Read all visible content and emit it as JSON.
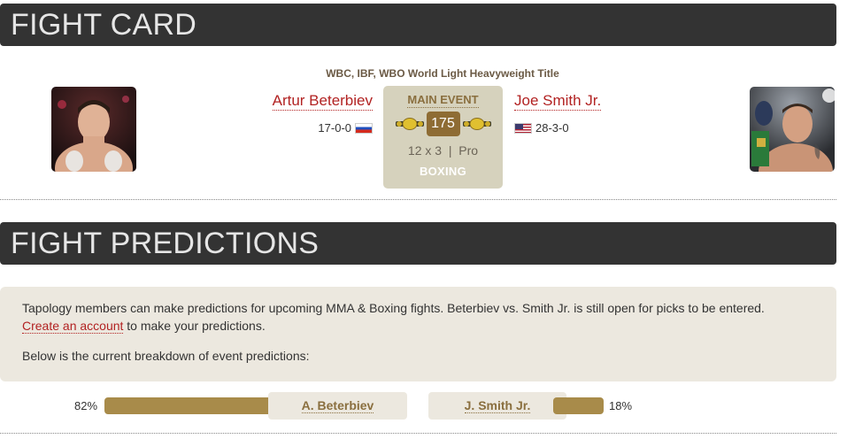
{
  "fight_card": {
    "header": "FIGHT CARD",
    "title_belt": "WBC, IBF, WBO World Light Heavyweight Title",
    "fighter_left": {
      "name": "Artur Beterbiev",
      "record": "17-0-0",
      "flag": "russia-flag-icon"
    },
    "fighter_right": {
      "name": "Joe Smith Jr.",
      "record": "28-3-0",
      "flag": "usa-flag-icon"
    },
    "event": {
      "label": "MAIN EVENT",
      "weight": "175",
      "rounds": "12 x 3",
      "separator": "|",
      "level": "Pro",
      "sport": "BOXING"
    }
  },
  "predictions": {
    "header": "FIGHT PREDICTIONS",
    "intro_text": "Tapology members can make predictions for upcoming MMA & Boxing fights. Beterbiev vs. Smith Jr. is still open for picks to be entered.",
    "link_text": "Create an account",
    "link_suffix": " to make your predictions.",
    "breakdown_text": "Below is the current breakdown of event predictions:",
    "left": {
      "percent_label": "82%",
      "percent": 82,
      "button": "A. Beterbiev"
    },
    "right": {
      "percent_label": "18%",
      "percent": 18,
      "button": "J. Smith Jr."
    }
  },
  "colors": {
    "header_bg": "#333333",
    "accent_red": "#b22222",
    "gold": "#a88b4a",
    "event_box": "#d6d2bd",
    "panel_bg": "#ece8df"
  }
}
